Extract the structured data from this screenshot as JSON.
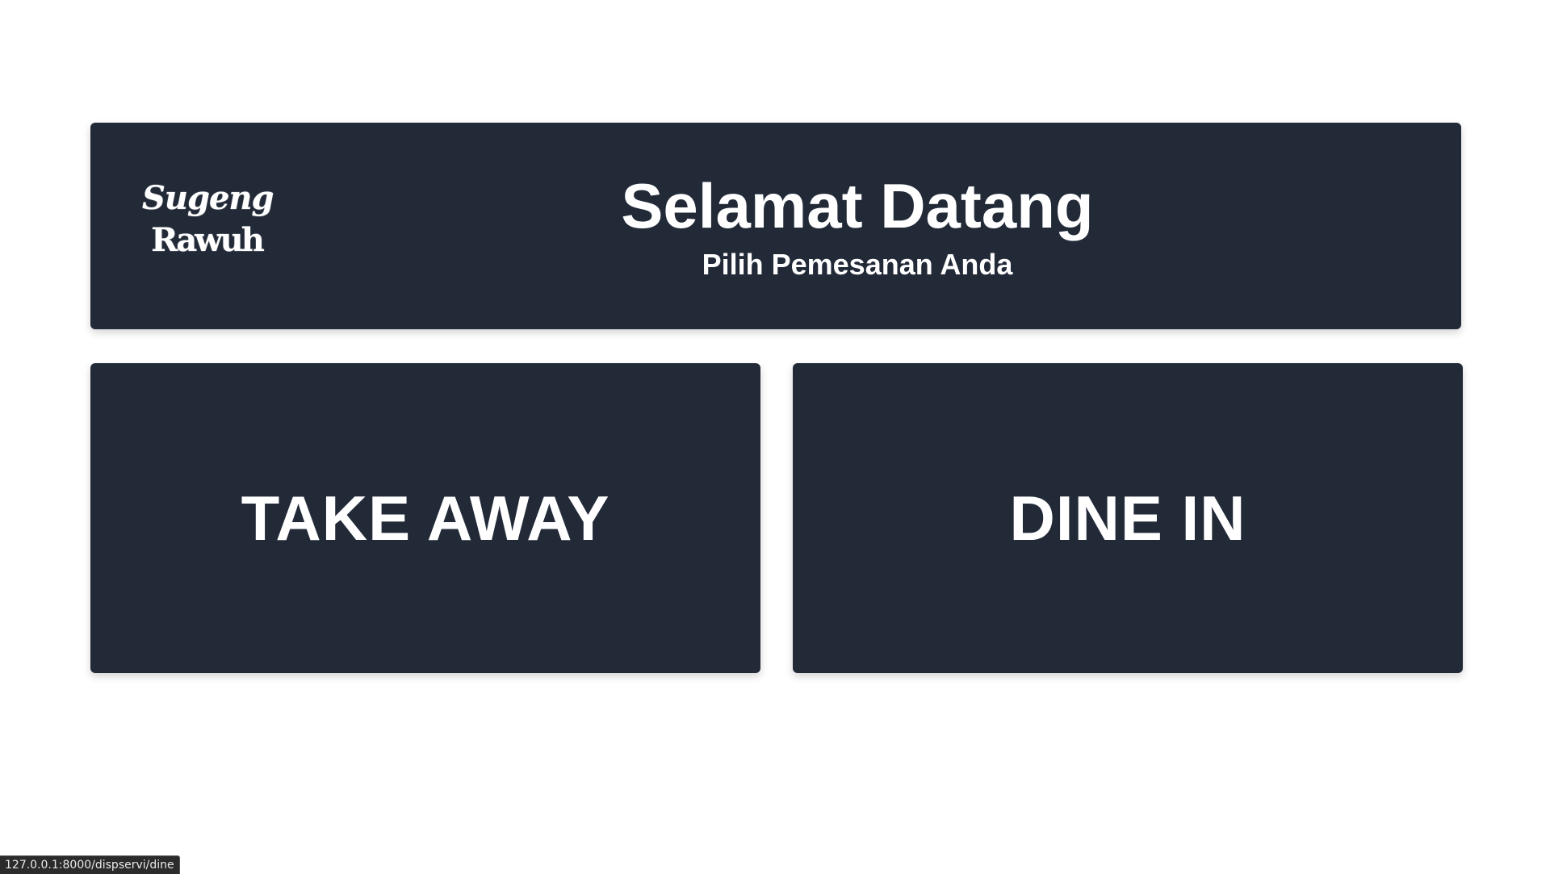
{
  "header": {
    "logo_line_1": "Sugeng",
    "logo_line_2": "Rawuh",
    "title": "Selamat Datang",
    "subtitle": "Pilih Pemesanan Anda"
  },
  "options": {
    "take_away_label": "TAKE AWAY",
    "dine_in_label": "DINE IN"
  },
  "status_bar": {
    "url": "127.0.0.1:8000/dispservi/dine"
  },
  "colors": {
    "background": "#ffffff",
    "card": "#222a38",
    "text": "#ffffff"
  }
}
